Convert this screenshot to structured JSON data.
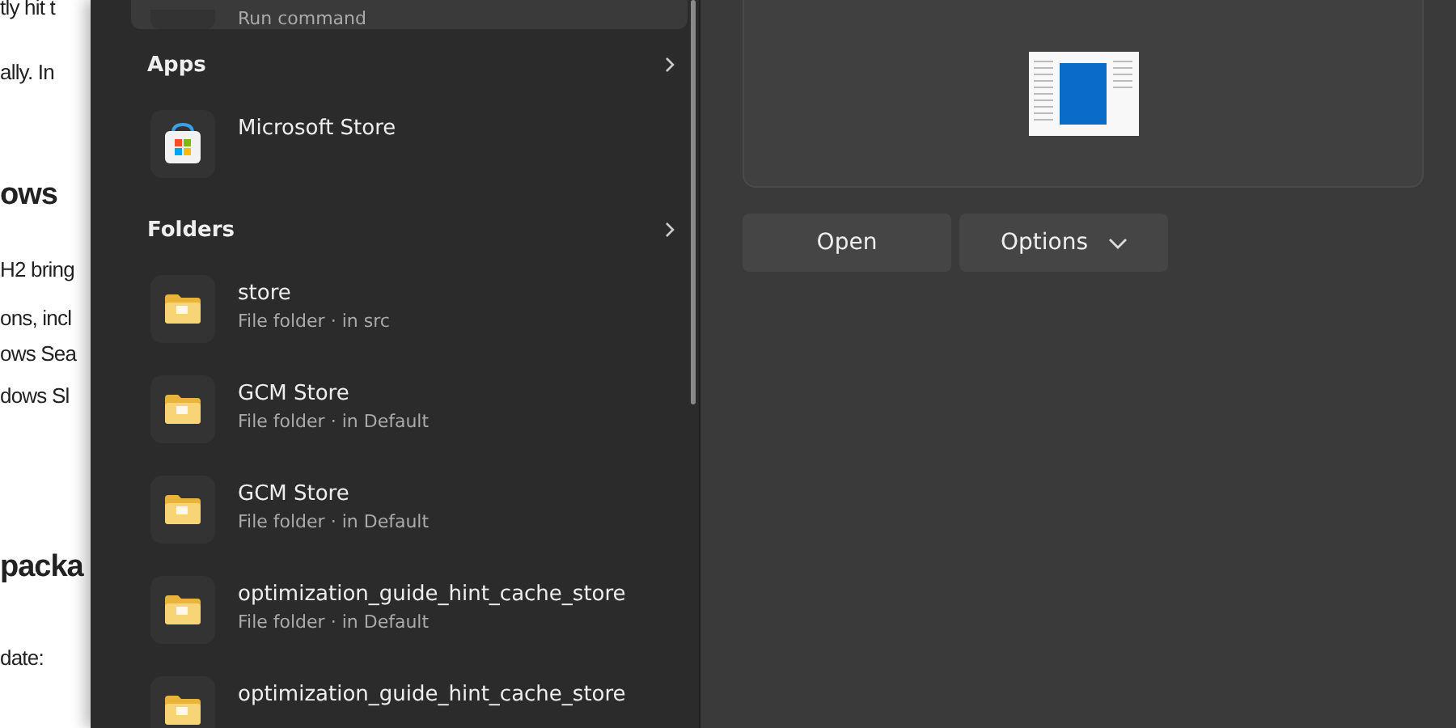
{
  "background_article": {
    "lines": [
      {
        "text": "tly hit t",
        "kind": "body"
      },
      {
        "text": "ally. In",
        "kind": "body"
      },
      {
        "text": "ows",
        "kind": "heading"
      },
      {
        "text": "H2 bring",
        "kind": "body"
      },
      {
        "text": "ons, incl",
        "kind": "body"
      },
      {
        "text": "ows Sea",
        "kind": "body"
      },
      {
        "text": "dows Sl",
        "kind": "body"
      },
      {
        "text": "packa",
        "kind": "heading"
      },
      {
        "text": "date:",
        "kind": "body"
      }
    ]
  },
  "search_results": {
    "top_item": {
      "subtitle": "Run command",
      "selected": true
    },
    "sections": [
      {
        "title": "Apps",
        "items": [
          {
            "name": "Microsoft Store",
            "kind": "app"
          }
        ]
      },
      {
        "title": "Folders",
        "items": [
          {
            "name": "store",
            "subtitle": "File folder · in src",
            "kind": "folder"
          },
          {
            "name": "GCM Store",
            "subtitle": "File folder · in Default",
            "kind": "folder"
          },
          {
            "name": "GCM Store",
            "subtitle": "File folder · in Default",
            "kind": "folder"
          },
          {
            "name": "optimization_guide_hint_cache_store",
            "subtitle": "File folder · in Default",
            "kind": "folder"
          },
          {
            "name": "optimization_guide_hint_cache_store",
            "kind": "folder"
          }
        ]
      }
    ]
  },
  "preview": {
    "buttons": [
      {
        "label": "Open",
        "kind": "plain"
      },
      {
        "label": "Options",
        "kind": "dropdown"
      }
    ]
  }
}
